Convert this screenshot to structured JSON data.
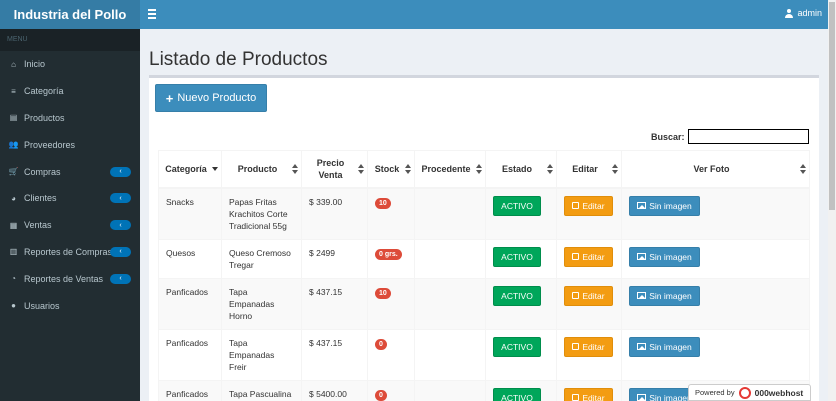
{
  "app": {
    "brand": "Industria del Pollo",
    "user": "admin"
  },
  "sidebar": {
    "header": "MENU",
    "items": [
      {
        "label": "Inicio",
        "icon": "home-icon",
        "glyph": "⌂",
        "submenu": false
      },
      {
        "label": "Categoría",
        "icon": "list-icon",
        "glyph": "≡",
        "submenu": false
      },
      {
        "label": "Productos",
        "icon": "products-icon",
        "glyph": "▤",
        "submenu": false
      },
      {
        "label": "Proveedores",
        "icon": "users-icon",
        "glyph": "👥",
        "submenu": false
      },
      {
        "label": "Compras",
        "icon": "cart-icon",
        "glyph": "🛒",
        "submenu": true
      },
      {
        "label": "Clientes",
        "icon": "pie-icon",
        "glyph": "◕",
        "submenu": true
      },
      {
        "label": "Ventas",
        "icon": "sales-icon",
        "glyph": "▦",
        "submenu": true
      },
      {
        "label": "Reportes de Compras",
        "icon": "bar-chart-icon",
        "glyph": "▥",
        "submenu": true
      },
      {
        "label": "Reportes de Ventas",
        "icon": "pie-chart-icon",
        "glyph": "◔",
        "submenu": true
      },
      {
        "label": "Usuarios",
        "icon": "user-icon",
        "glyph": "●",
        "submenu": false
      }
    ],
    "submenu_glyph": "‹"
  },
  "main": {
    "title": "Listado de Productos",
    "new_button": "Nuevo Producto",
    "search_label": "Buscar:",
    "search_value": "",
    "columns": [
      "Categoría",
      "Producto",
      "Precio Venta",
      "Stock",
      "Procedente",
      "Estado",
      "Editar",
      "Ver Foto"
    ],
    "rows": [
      {
        "categoria": "Snacks",
        "producto": "Papas Fritas Krachitos Corte Tradicional 55g",
        "precio": "$ 339.00",
        "stock": "10",
        "procedente": "",
        "estado": "ACTIVO",
        "editar": "Editar",
        "foto": "Sin imagen"
      },
      {
        "categoria": "Quesos",
        "producto": "Queso Cremoso Tregar",
        "precio": "$ 2499",
        "stock": "0 grs.",
        "procedente": "",
        "estado": "ACTIVO",
        "editar": "Editar",
        "foto": "Sin imagen"
      },
      {
        "categoria": "Panficados",
        "producto": "Tapa Empanadas Horno",
        "precio": "$ 437.15",
        "stock": "10",
        "procedente": "",
        "estado": "ACTIVO",
        "editar": "Editar",
        "foto": "Sin imagen"
      },
      {
        "categoria": "Panficados",
        "producto": "Tapa Empanadas Freir",
        "precio": "$ 437.15",
        "stock": "0",
        "procedente": "",
        "estado": "ACTIVO",
        "editar": "Editar",
        "foto": "Sin imagen"
      },
      {
        "categoria": "Panficados",
        "producto": "Tapa Pascualina",
        "precio": "$ 5400.00",
        "stock": "0",
        "procedente": "",
        "estado": "ACTIVO",
        "editar": "Editar",
        "foto": "Sin imagen"
      }
    ]
  },
  "footer_badge": {
    "prefix": "Powered by",
    "name": "000webhost"
  },
  "colors": {
    "header": "#3c8dbc",
    "brand": "#357ca5",
    "sidebar": "#222d32",
    "success": "#00a65a",
    "warning": "#f39c12",
    "danger": "#dd4b39"
  }
}
